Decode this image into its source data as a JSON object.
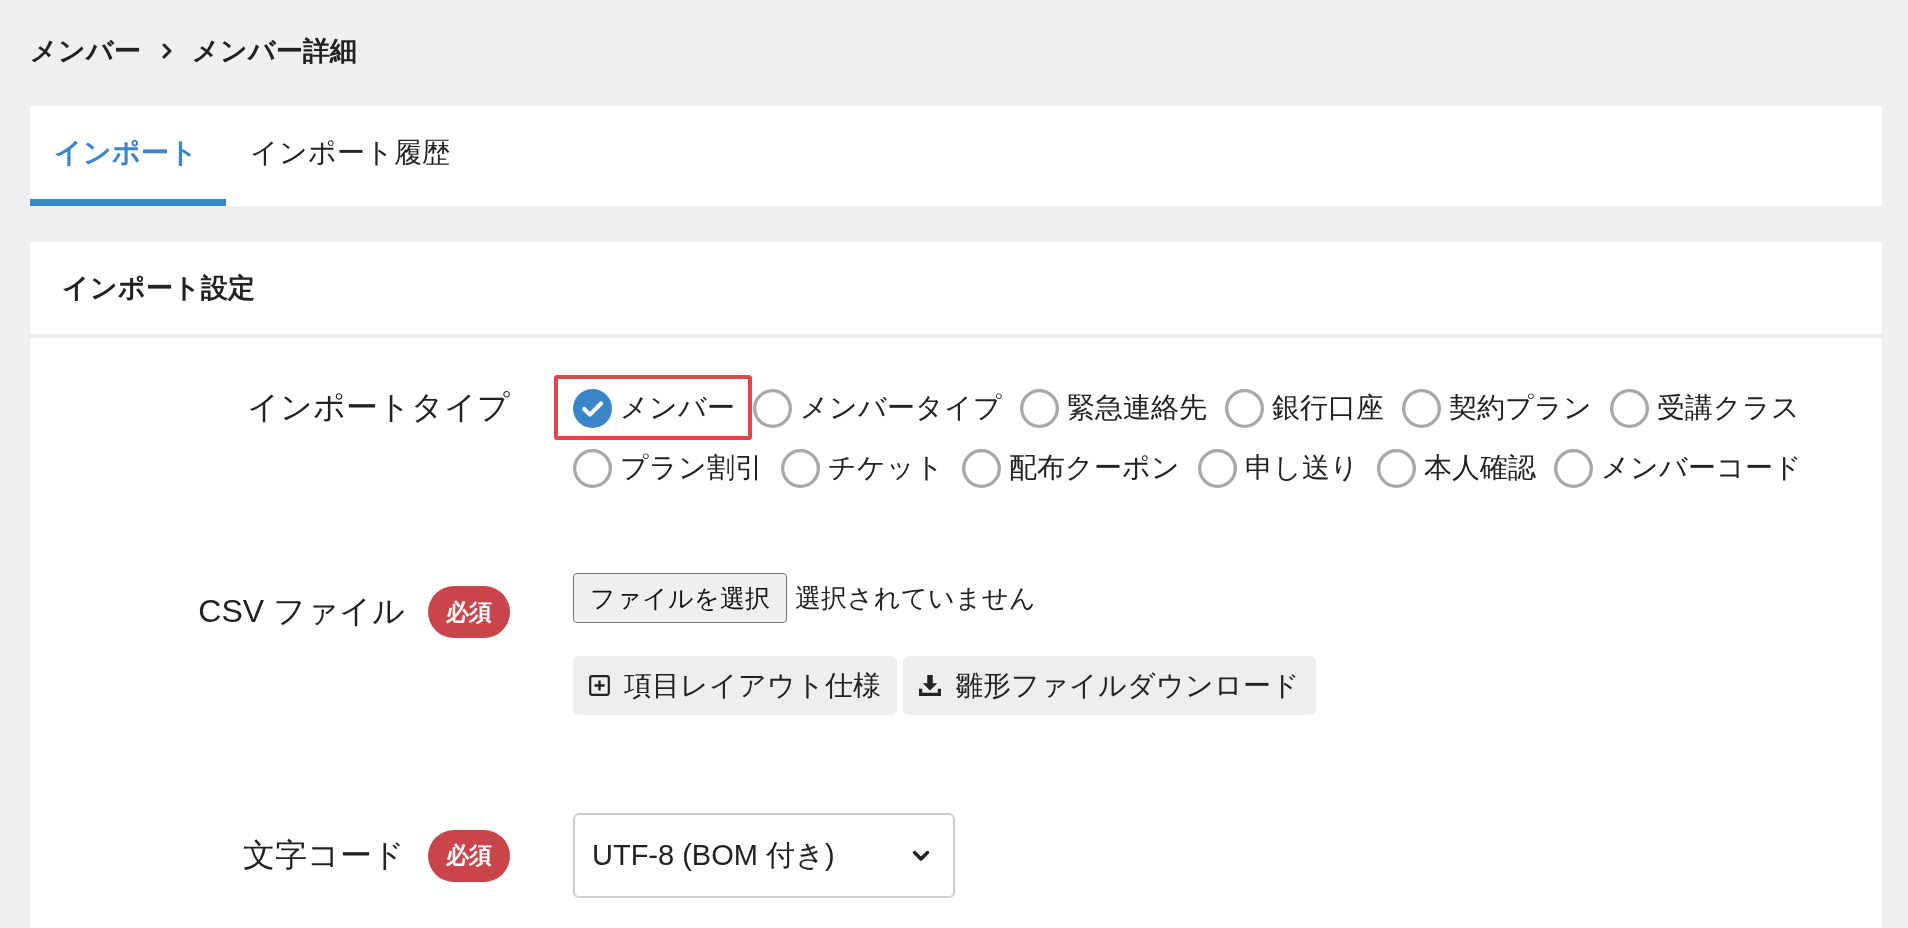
{
  "breadcrumb": [
    "メンバー",
    "メンバー詳細"
  ],
  "tabs": [
    {
      "label": "インポート",
      "selected": true
    },
    {
      "label": "インポート履歴",
      "selected": false
    }
  ],
  "import_settings": {
    "title": "インポート設定",
    "import_type": {
      "label": "インポートタイプ",
      "options": [
        {
          "label": "メンバー",
          "selected": true,
          "highlighted": true
        },
        {
          "label": "メンバータイプ",
          "selected": false,
          "highlighted": false
        },
        {
          "label": "緊急連絡先",
          "selected": false,
          "highlighted": false
        },
        {
          "label": "銀行口座",
          "selected": false,
          "highlighted": false
        },
        {
          "label": "契約プラン",
          "selected": false,
          "highlighted": false
        },
        {
          "label": "受講クラス",
          "selected": false,
          "highlighted": false
        },
        {
          "label": "プラン割引",
          "selected": false,
          "highlighted": false
        },
        {
          "label": "チケット",
          "selected": false,
          "highlighted": false
        },
        {
          "label": "配布クーポン",
          "selected": false,
          "highlighted": false
        },
        {
          "label": "申し送り",
          "selected": false,
          "highlighted": false
        },
        {
          "label": "本人確認",
          "selected": false,
          "highlighted": false
        },
        {
          "label": "メンバーコード",
          "selected": false,
          "highlighted": false
        }
      ]
    },
    "csv_file": {
      "label": "CSV ファイル",
      "required_badge": "必須",
      "choose_button": "ファイルを選択",
      "status": "選択されていません",
      "actions": [
        {
          "kind": "spec",
          "label": "項目レイアウト仕様"
        },
        {
          "kind": "download",
          "label": "雛形ファイルダウンロード"
        }
      ]
    },
    "encoding": {
      "label": "文字コード",
      "required_badge": "必須",
      "value": "UTF-8 (BOM 付き)"
    }
  }
}
